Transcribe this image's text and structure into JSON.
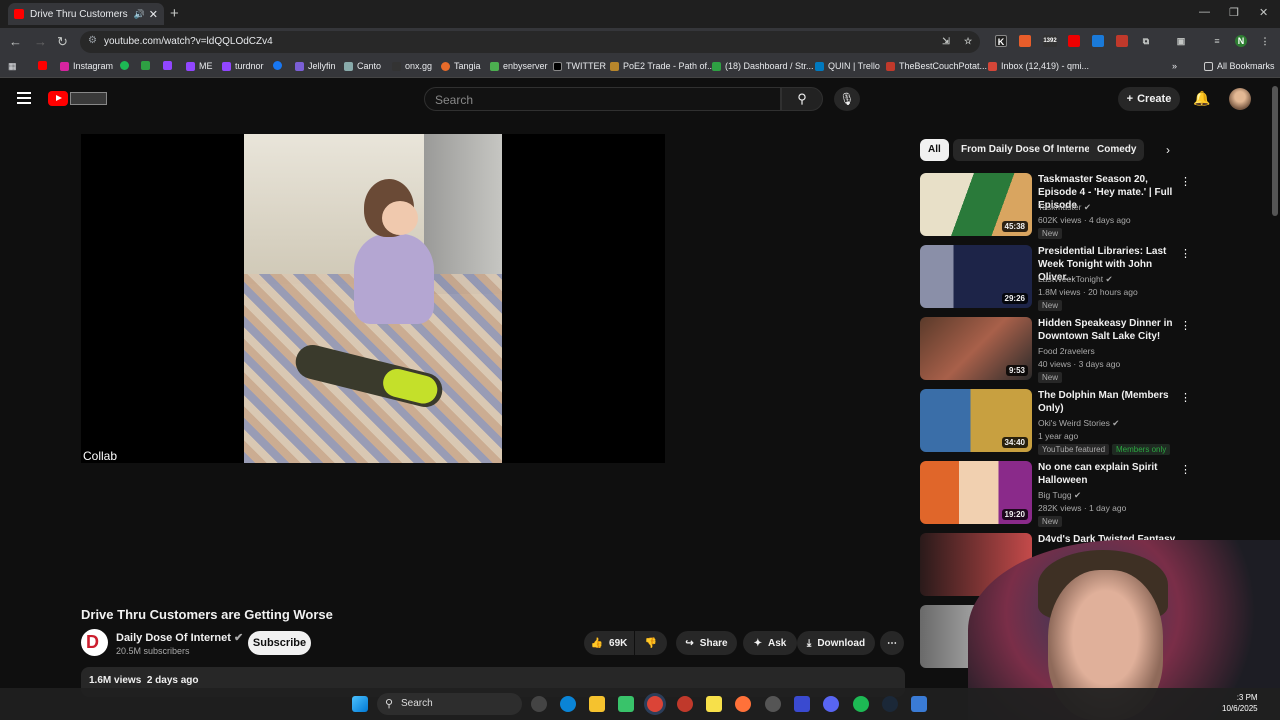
{
  "browser": {
    "tab_title": "Drive Thru Customers are G",
    "url": "youtube.com/watch?v=ldQQLOdCZv4",
    "bookmarks": [
      "Instagram",
      "ME",
      "turdnor",
      "Jellyfin",
      "Canto",
      "onx.gg",
      "Tangia",
      "enbyserver",
      "TWITTER",
      "PoE2 Trade - Path of...",
      "(18) Dashboard / Str...",
      "QUIN | Trello",
      "TheBestCouchPotat...",
      "Inbox (12,419) - qmi...",
      "All Bookmarks"
    ],
    "ext_badge": "1392"
  },
  "header": {
    "search_placeholder": "Search",
    "create_label": "Create"
  },
  "video": {
    "overlay_label": "Collab",
    "title": "Drive Thru Customers are Getting Worse",
    "channel": "Daily Dose Of Internet",
    "subscribers": "20.5M subscribers",
    "subscribe_label": "Subscribe",
    "likes": "69K",
    "share_label": "Share",
    "ask_label": "Ask",
    "download_label": "Download",
    "views": "1.6M views",
    "age": "2 days ago"
  },
  "chips": [
    "All",
    "From Daily Dose Of Internet",
    "Comedy"
  ],
  "recommendations": [
    {
      "title": "Taskmaster Season 20, Episode 4 - 'Hey mate.' | Full Episode",
      "channel": "Taskmaster",
      "meta": "602K views · 4 days ago",
      "badge": "New",
      "duration": "45:38"
    },
    {
      "title": "Presidential Libraries: Last Week Tonight with John Oliver...",
      "channel": "LastWeekTonight",
      "meta": "1.8M views · 20 hours ago",
      "badge": "New",
      "duration": "29:26"
    },
    {
      "title": "Hidden Speakeasy Dinner in Downtown Salt Lake City!",
      "channel": "Food 2ravelers",
      "meta": "40 views · 3 days ago",
      "badge": "New",
      "duration": "9:53"
    },
    {
      "title": "The Dolphin Man (Members Only)",
      "channel": "Oki's Weird Stories",
      "meta": "1 year ago",
      "badge": "YouTube featured",
      "badge2": "Members only",
      "duration": "34:40"
    },
    {
      "title": "No one can explain Spirit Halloween",
      "channel": "Big Tugg",
      "meta": "282K views · 1 day ago",
      "badge": "New",
      "duration": "19:20"
    },
    {
      "title": "D4vd's Dark Twisted Fantasy"
    }
  ],
  "taskbar": {
    "search_label": "Search",
    "time": ":3 PM",
    "date": "10/6/2025"
  }
}
